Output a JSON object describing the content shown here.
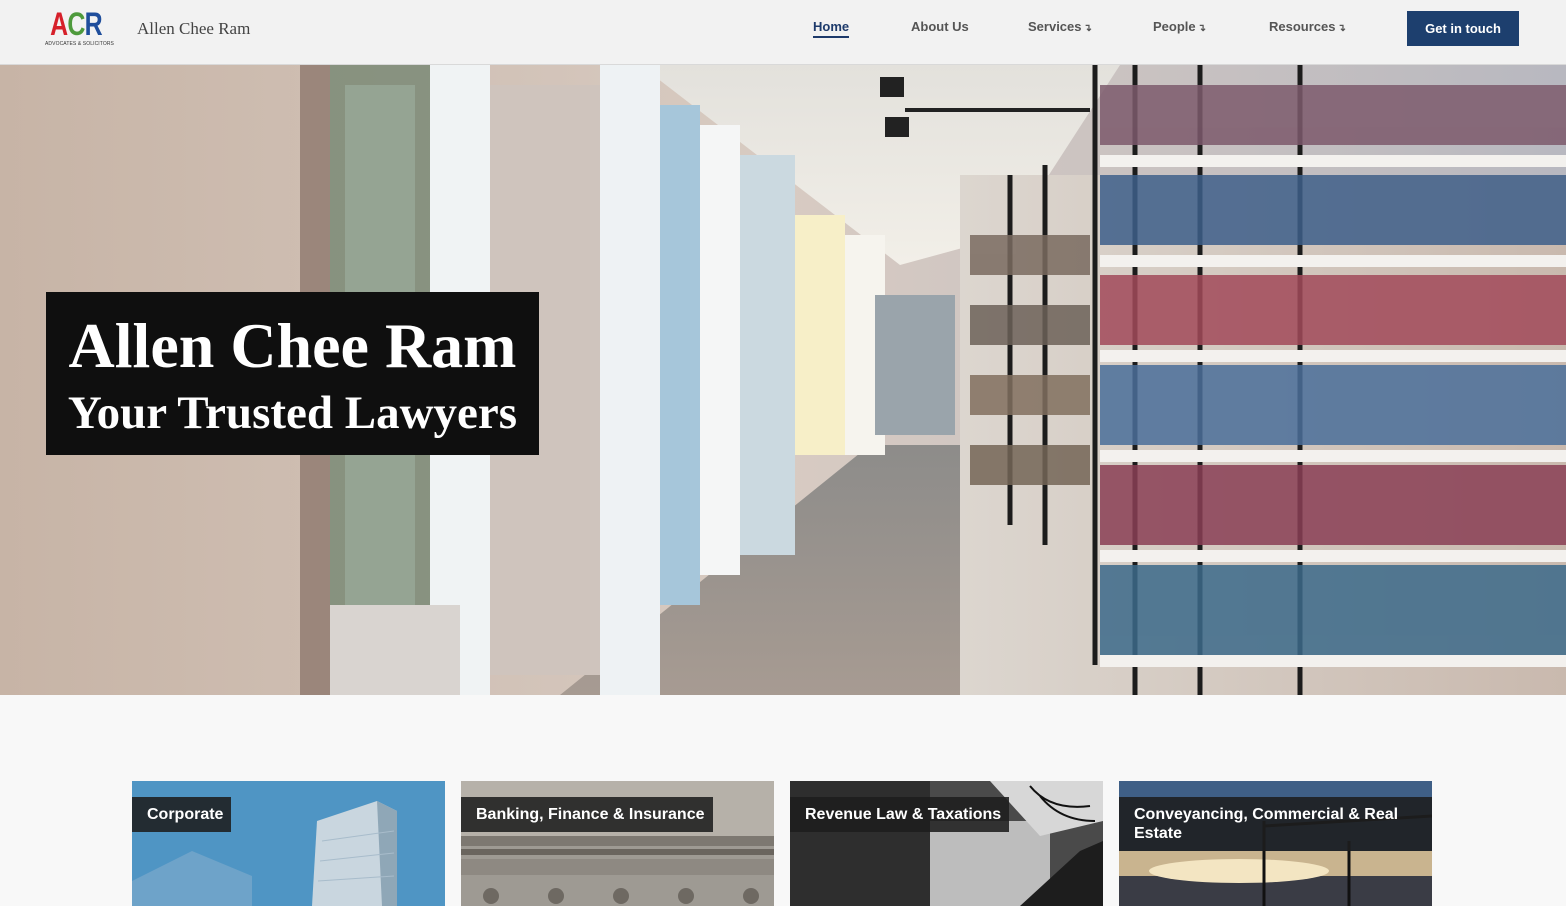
{
  "header": {
    "logo_letters": [
      "A",
      "C",
      "R"
    ],
    "logo_subtitle": "ADVOCATES & SOLICITORS",
    "brand_name": "Allen Chee Ram",
    "cta_label": "Get in touch"
  },
  "nav": {
    "items": [
      {
        "label": "Home",
        "active": true,
        "dropdown": false
      },
      {
        "label": "About Us",
        "active": false,
        "dropdown": false
      },
      {
        "label": "Services",
        "active": false,
        "dropdown": true
      },
      {
        "label": "People",
        "active": false,
        "dropdown": true
      },
      {
        "label": "Resources",
        "active": false,
        "dropdown": true
      }
    ],
    "dropdown_icon": "arrow-down-right-icon"
  },
  "hero": {
    "title": "Allen Chee Ram",
    "subtitle": "Your Trusted Lawyers",
    "background": "library-corridor-photo"
  },
  "practice_areas": [
    {
      "label": "Corporate",
      "image": "glass-skyscraper-photo"
    },
    {
      "label": "Banking, Finance & Insurance",
      "image": "classical-building-facade-photo"
    },
    {
      "label": "Revenue Law & Taxations",
      "image": "fern-leaf-photo"
    },
    {
      "label": "Conveyancing, Commercial & Real Estate",
      "image": "construction-crane-sunset-photo"
    }
  ],
  "colors": {
    "primary": "#1d3f6e",
    "nav_active": "#1d3a6b",
    "hero_box": "#0f0f0f",
    "logo_a": "#d6202a",
    "logo_c": "#4e9a3c",
    "logo_r": "#1f4e9c"
  }
}
